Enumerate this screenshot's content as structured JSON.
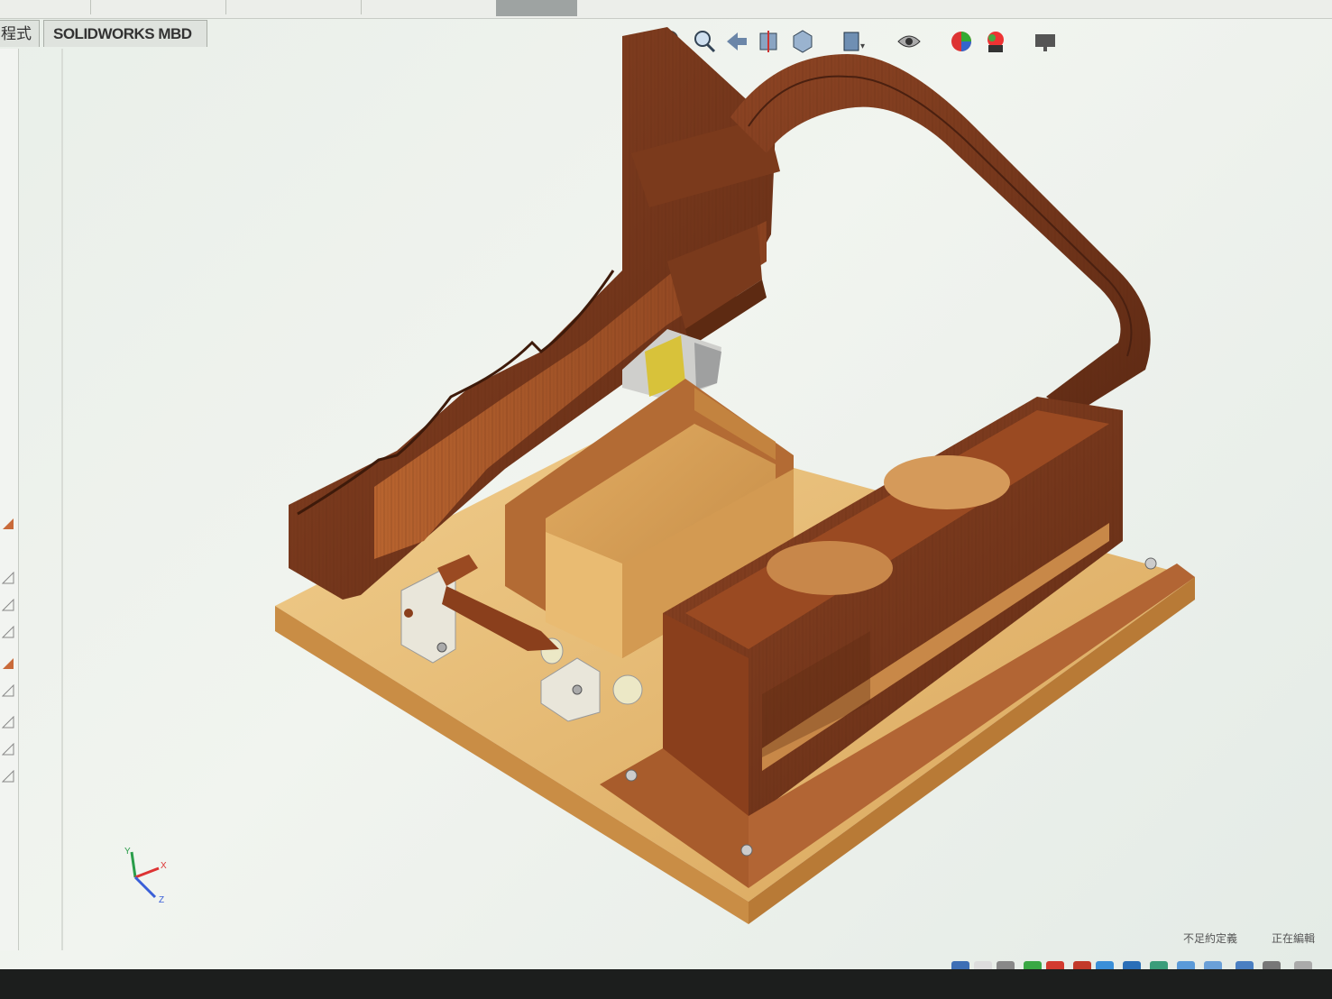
{
  "tabs": {
    "partial_label": "程式",
    "mbd_label": "SOLIDWORKS MBD"
  },
  "toolbar_icons": [
    "zoom-to-fit-icon",
    "zoom-area-icon",
    "previous-view-icon",
    "section-view-icon",
    "view-orientation-icon",
    "display-style-icon",
    "hide-show-icon",
    "edit-appearance-icon",
    "apply-scene-icon",
    "view-settings-icon"
  ],
  "status": {
    "left_text": "不足約定義",
    "right_text": "正在編輯"
  },
  "colors": {
    "viewport_bg": "#eef2ee",
    "dark_wood": "#7a3a1c",
    "mid_wood": "#a0522d",
    "light_wood": "#d9a25a",
    "base_wood": "#e8c17e",
    "metal": "#d8d4c8",
    "accent_yellow": "#d8c23a"
  },
  "triad": {
    "x_label": "X",
    "y_label": "Y",
    "z_label": "Z"
  }
}
